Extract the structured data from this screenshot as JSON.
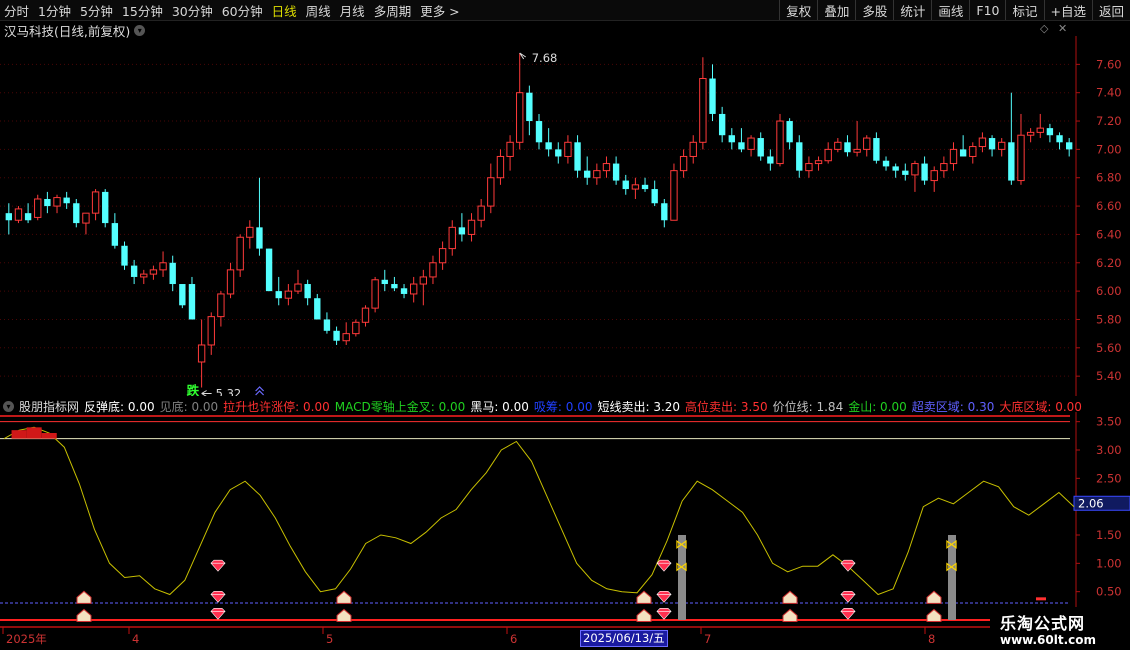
{
  "toolbar": {
    "periods": [
      "分时",
      "1分钟",
      "5分钟",
      "15分钟",
      "30分钟",
      "60分钟",
      "日线",
      "周线",
      "月线",
      "多周期",
      "更多 >"
    ],
    "active_period": "日线",
    "actions": [
      "复权",
      "叠加",
      "多股",
      "统计",
      "画线",
      "F10",
      "标记",
      "+自选",
      "返回"
    ]
  },
  "stock": {
    "title": "汉马科技(日线,前复权)"
  },
  "price_axis": {
    "ticks": [
      "7.60",
      "7.40",
      "7.20",
      "7.00",
      "6.80",
      "6.60",
      "6.40",
      "6.20",
      "6.00",
      "5.80",
      "5.60",
      "5.40"
    ]
  },
  "annotations": {
    "high": "7.68",
    "low": "5.32",
    "low_marker": "跌"
  },
  "indicator": {
    "name": "股朋指标网",
    "items": [
      {
        "label": "反弹底:",
        "value": "0.00",
        "color": "#ffffff"
      },
      {
        "label": "见底:",
        "value": "0.00",
        "color": "#808080"
      },
      {
        "label": "拉升也许涨停:",
        "value": "0.00",
        "color": "#ff3030"
      },
      {
        "label": "MACD零轴上金叉:",
        "value": "0.00",
        "color": "#20d020"
      },
      {
        "label": "黑马:",
        "value": "0.00",
        "color": "#ffffff"
      },
      {
        "label": "吸筹:",
        "value": "0.00",
        "color": "#2040ff"
      },
      {
        "label": "短线卖出:",
        "value": "3.20",
        "color": "#ffffff"
      },
      {
        "label": "高位卖出:",
        "value": "3.50",
        "color": "#ff3030"
      },
      {
        "label": "价位线:",
        "value": "1.84",
        "color": "#c0c0c0"
      },
      {
        "label": "金山:",
        "value": "0.00",
        "color": "#20d020"
      },
      {
        "label": "超卖区域:",
        "value": "0.30",
        "color": "#6060ff"
      },
      {
        "label": "大底区域:",
        "value": "0.00",
        "color": "#ff3030"
      }
    ],
    "axis_ticks": [
      "3.50",
      "3.00",
      "2.50",
      "2.00",
      "1.50",
      "1.00",
      "0.50"
    ],
    "current_value": "2.06"
  },
  "date_axis": {
    "labels": [
      "2025年",
      "4",
      "5",
      "6",
      "7",
      "8"
    ],
    "cursor_date": "2025/06/13/五"
  },
  "watermark": {
    "line1": "乐淘公式网",
    "line2": "www.60lt.com"
  },
  "colors": {
    "up": "#ff3a3a",
    "down": "#54ffff",
    "axis": "#b01010",
    "accent": "#ffff00"
  },
  "chart_data": {
    "type": "candlestick",
    "candles_ohlc": [
      [
        6.55,
        6.62,
        6.4,
        6.5
      ],
      [
        6.5,
        6.6,
        6.48,
        6.58
      ],
      [
        6.55,
        6.62,
        6.48,
        6.5
      ],
      [
        6.52,
        6.68,
        6.5,
        6.65
      ],
      [
        6.65,
        6.7,
        6.55,
        6.6
      ],
      [
        6.6,
        6.68,
        6.55,
        6.66
      ],
      [
        6.66,
        6.7,
        6.58,
        6.62
      ],
      [
        6.62,
        6.65,
        6.45,
        6.48
      ],
      [
        6.48,
        6.55,
        6.4,
        6.55
      ],
      [
        6.55,
        6.72,
        6.5,
        6.7
      ],
      [
        6.7,
        6.72,
        6.45,
        6.48
      ],
      [
        6.48,
        6.55,
        6.3,
        6.32
      ],
      [
        6.32,
        6.35,
        6.15,
        6.18
      ],
      [
        6.18,
        6.22,
        6.05,
        6.1
      ],
      [
        6.1,
        6.15,
        6.05,
        6.12
      ],
      [
        6.12,
        6.18,
        6.08,
        6.15
      ],
      [
        6.15,
        6.28,
        6.1,
        6.2
      ],
      [
        6.2,
        6.25,
        6.0,
        6.05
      ],
      [
        6.05,
        5.92,
        5.88,
        5.9
      ],
      [
        6.05,
        6.1,
        5.8,
        5.8
      ],
      [
        5.5,
        5.8,
        5.32,
        5.62
      ],
      [
        5.62,
        5.85,
        5.55,
        5.82
      ],
      [
        5.82,
        6.0,
        5.75,
        5.98
      ],
      [
        5.98,
        6.2,
        5.95,
        6.15
      ],
      [
        6.15,
        6.4,
        6.1,
        6.38
      ],
      [
        6.38,
        6.5,
        6.3,
        6.45
      ],
      [
        6.45,
        6.8,
        6.25,
        6.3
      ],
      [
        6.3,
        6.3,
        6.0,
        6.0
      ],
      [
        6.0,
        6.1,
        5.9,
        5.95
      ],
      [
        5.95,
        6.05,
        5.9,
        6.0
      ],
      [
        6.0,
        6.15,
        5.98,
        6.05
      ],
      [
        6.05,
        6.08,
        5.9,
        5.95
      ],
      [
        5.95,
        5.98,
        5.8,
        5.8
      ],
      [
        5.8,
        5.85,
        5.7,
        5.72
      ],
      [
        5.72,
        5.75,
        5.62,
        5.65
      ],
      [
        5.65,
        5.78,
        5.62,
        5.7
      ],
      [
        5.7,
        5.8,
        5.68,
        5.78
      ],
      [
        5.78,
        5.9,
        5.75,
        5.88
      ],
      [
        5.88,
        6.1,
        5.85,
        6.08
      ],
      [
        6.08,
        6.15,
        6.0,
        6.05
      ],
      [
        6.05,
        6.1,
        6.0,
        6.02
      ],
      [
        6.02,
        6.05,
        5.95,
        5.98
      ],
      [
        5.98,
        6.1,
        5.92,
        6.05
      ],
      [
        6.05,
        6.15,
        5.9,
        6.1
      ],
      [
        6.1,
        6.25,
        6.05,
        6.2
      ],
      [
        6.2,
        6.35,
        6.15,
        6.3
      ],
      [
        6.3,
        6.5,
        6.25,
        6.45
      ],
      [
        6.45,
        6.55,
        6.35,
        6.4
      ],
      [
        6.4,
        6.55,
        6.35,
        6.5
      ],
      [
        6.5,
        6.65,
        6.45,
        6.6
      ],
      [
        6.6,
        6.9,
        6.55,
        6.8
      ],
      [
        6.8,
        7.0,
        6.75,
        6.95
      ],
      [
        6.95,
        7.1,
        6.85,
        7.05
      ],
      [
        7.05,
        7.68,
        7.0,
        7.4
      ],
      [
        7.4,
        7.45,
        7.1,
        7.2
      ],
      [
        7.2,
        7.25,
        7.0,
        7.05
      ],
      [
        7.05,
        7.15,
        6.95,
        7.0
      ],
      [
        7.0,
        7.05,
        6.9,
        6.95
      ],
      [
        6.95,
        7.1,
        6.9,
        7.05
      ],
      [
        7.05,
        7.1,
        6.8,
        6.85
      ],
      [
        6.85,
        6.95,
        6.75,
        6.8
      ],
      [
        6.8,
        6.9,
        6.75,
        6.85
      ],
      [
        6.85,
        6.95,
        6.8,
        6.9
      ],
      [
        6.9,
        6.95,
        6.75,
        6.78
      ],
      [
        6.78,
        6.82,
        6.68,
        6.72
      ],
      [
        6.72,
        6.8,
        6.65,
        6.75
      ],
      [
        6.75,
        6.8,
        6.7,
        6.72
      ],
      [
        6.72,
        6.78,
        6.6,
        6.62
      ],
      [
        6.62,
        6.65,
        6.45,
        6.5
      ],
      [
        6.5,
        6.9,
        6.5,
        6.85
      ],
      [
        6.85,
        7.0,
        6.8,
        6.95
      ],
      [
        6.95,
        7.1,
        6.9,
        7.05
      ],
      [
        7.05,
        7.65,
        7.0,
        7.5
      ],
      [
        7.5,
        7.6,
        7.2,
        7.25
      ],
      [
        7.25,
        7.3,
        7.05,
        7.1
      ],
      [
        7.1,
        7.15,
        7.0,
        7.05
      ],
      [
        7.05,
        7.15,
        6.98,
        7.0
      ],
      [
        7.0,
        7.1,
        6.95,
        7.08
      ],
      [
        7.08,
        7.12,
        6.92,
        6.95
      ],
      [
        6.95,
        7.0,
        6.85,
        6.9
      ],
      [
        6.9,
        7.25,
        6.88,
        7.2
      ],
      [
        7.2,
        7.22,
        7.0,
        7.05
      ],
      [
        7.05,
        7.1,
        6.8,
        6.85
      ],
      [
        6.85,
        6.95,
        6.8,
        6.9
      ],
      [
        6.9,
        6.95,
        6.85,
        6.92
      ],
      [
        6.92,
        7.05,
        6.9,
        7.0
      ],
      [
        7.0,
        7.08,
        6.98,
        7.05
      ],
      [
        7.05,
        7.1,
        6.95,
        6.98
      ],
      [
        6.98,
        7.2,
        6.95,
        7.0
      ],
      [
        7.0,
        7.1,
        6.95,
        7.08
      ],
      [
        7.08,
        7.12,
        6.9,
        6.92
      ],
      [
        6.92,
        6.95,
        6.85,
        6.88
      ],
      [
        6.88,
        6.9,
        6.8,
        6.85
      ],
      [
        6.85,
        6.9,
        6.78,
        6.82
      ],
      [
        6.82,
        6.92,
        6.7,
        6.9
      ],
      [
        6.9,
        6.95,
        6.75,
        6.78
      ],
      [
        6.78,
        6.88,
        6.7,
        6.85
      ],
      [
        6.85,
        6.95,
        6.8,
        6.9
      ],
      [
        6.9,
        7.05,
        6.85,
        7.0
      ],
      [
        7.0,
        7.1,
        6.95,
        6.95
      ],
      [
        6.95,
        7.05,
        6.9,
        7.02
      ],
      [
        7.02,
        7.12,
        6.98,
        7.08
      ],
      [
        7.08,
        7.1,
        6.95,
        7.0
      ],
      [
        7.0,
        7.08,
        6.95,
        7.05
      ],
      [
        7.05,
        7.4,
        6.75,
        6.78
      ],
      [
        6.78,
        7.25,
        6.75,
        7.1
      ],
      [
        7.1,
        7.15,
        7.05,
        7.12
      ],
      [
        7.12,
        7.25,
        7.08,
        7.15
      ],
      [
        7.15,
        7.18,
        7.05,
        7.1
      ],
      [
        7.1,
        7.12,
        7.0,
        7.05
      ],
      [
        7.05,
        7.08,
        6.95,
        7.0
      ]
    ],
    "oscillator_values": [
      3.2,
      3.35,
      3.4,
      3.3,
      3.05,
      2.4,
      1.6,
      1.0,
      0.75,
      0.78,
      0.55,
      0.45,
      0.7,
      1.3,
      1.9,
      2.3,
      2.45,
      2.2,
      1.8,
      1.3,
      0.85,
      0.5,
      0.55,
      0.9,
      1.35,
      1.5,
      1.45,
      1.35,
      1.55,
      1.8,
      1.95,
      2.3,
      2.6,
      3.0,
      3.15,
      2.8,
      2.2,
      1.6,
      1.0,
      0.7,
      0.55,
      0.5,
      0.48,
      0.8,
      1.4,
      2.1,
      2.45,
      2.3,
      2.1,
      1.9,
      1.5,
      1.0,
      0.85,
      0.95,
      0.95,
      1.15,
      0.95,
      0.7,
      0.45,
      0.55,
      1.2,
      2.0,
      2.15,
      2.05,
      2.25,
      2.45,
      2.35,
      2.0,
      1.85,
      2.05,
      2.25,
      2.0
    ],
    "ylim": [
      0.0,
      3.6
    ],
    "price_ylim": [
      5.26,
      7.8
    ]
  }
}
